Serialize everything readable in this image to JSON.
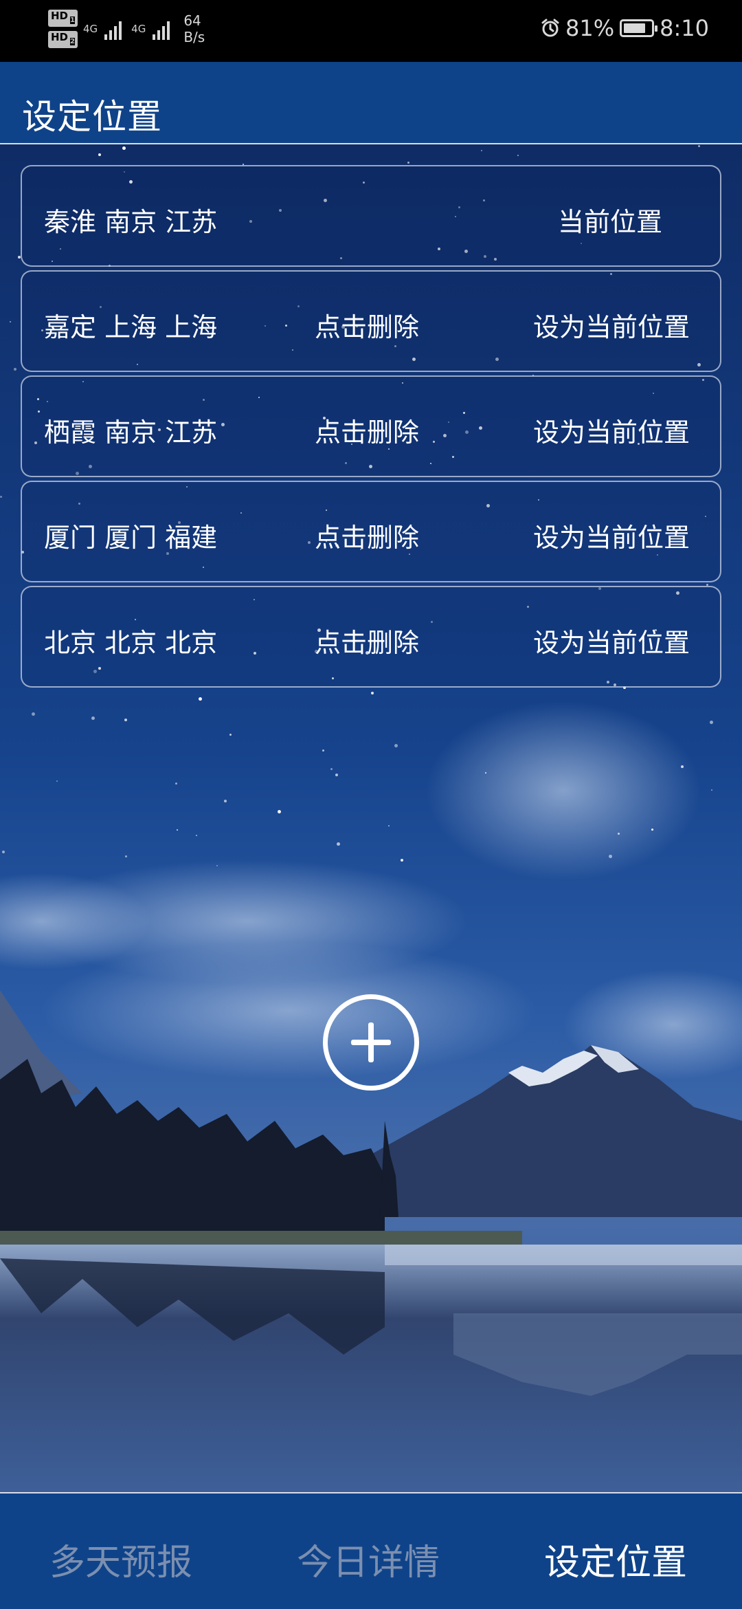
{
  "status_bar": {
    "hd1": "HD",
    "hd1_sub": "1",
    "hd2": "HD",
    "hd2_sub": "2",
    "net1": "4G",
    "net2": "4G",
    "speed_value": "64",
    "speed_unit": "B/s",
    "battery_percent": "81%",
    "battery_level": 0.81,
    "time": "8:10",
    "icons": [
      "alarm-icon",
      "battery-icon",
      "signal-icon"
    ]
  },
  "header": {
    "title": "设定位置"
  },
  "locations": [
    {
      "name": "秦淮 南京 江苏",
      "delete_label": "",
      "action_label": "当前位置"
    },
    {
      "name": "嘉定 上海 上海",
      "delete_label": "点击删除",
      "action_label": "设为当前位置"
    },
    {
      "name": "栖霞 南京 江苏",
      "delete_label": "点击删除",
      "action_label": "设为当前位置"
    },
    {
      "name": "厦门 厦门 福建",
      "delete_label": "点击删除",
      "action_label": "设为当前位置"
    },
    {
      "name": "北京 北京 北京",
      "delete_label": "点击删除",
      "action_label": "设为当前位置"
    }
  ],
  "add_button": {
    "icon": "plus-circle-icon"
  },
  "bottom_nav": {
    "items": [
      {
        "label": "多天预报",
        "active": false
      },
      {
        "label": "今日详情",
        "active": false
      },
      {
        "label": "设定位置",
        "active": true
      }
    ]
  },
  "colors": {
    "header_bg": "#0f4389",
    "nav_inactive": "#7b8fb0",
    "nav_active": "#ffffff"
  }
}
